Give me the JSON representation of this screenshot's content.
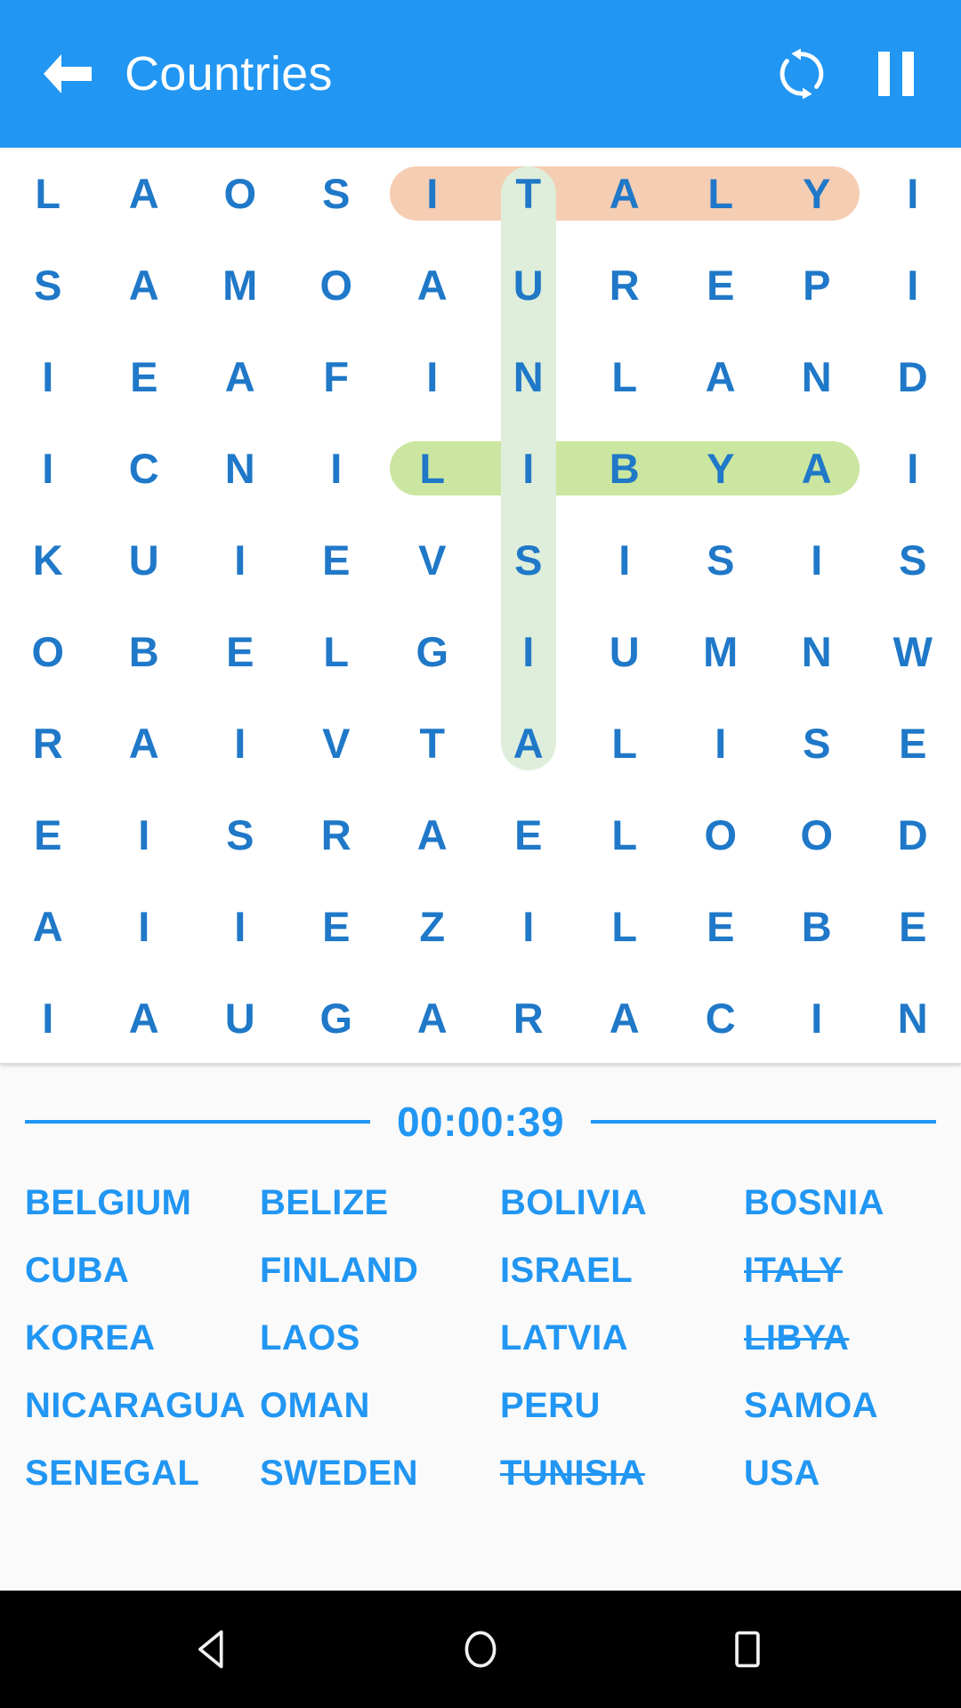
{
  "appbar": {
    "title": "Countries",
    "back_icon": "arrow-left-icon",
    "shuffle_icon": "refresh-shuffle-icon",
    "pause_icon": "pause-icon"
  },
  "grid": {
    "rows": 10,
    "cols": 10,
    "letters": [
      [
        "L",
        "A",
        "O",
        "S",
        "I",
        "T",
        "A",
        "L",
        "Y",
        "I"
      ],
      [
        "S",
        "A",
        "M",
        "O",
        "A",
        "U",
        "R",
        "E",
        "P",
        "I"
      ],
      [
        "I",
        "E",
        "A",
        "F",
        "I",
        "N",
        "L",
        "A",
        "N",
        "D"
      ],
      [
        "I",
        "C",
        "N",
        "I",
        "L",
        "I",
        "B",
        "Y",
        "A",
        "I"
      ],
      [
        "K",
        "U",
        "I",
        "E",
        "V",
        "S",
        "I",
        "S",
        "I",
        "S"
      ],
      [
        "O",
        "B",
        "E",
        "L",
        "G",
        "I",
        "U",
        "M",
        "N",
        "W"
      ],
      [
        "R",
        "A",
        "I",
        "V",
        "T",
        "A",
        "L",
        "I",
        "S",
        "E"
      ],
      [
        "E",
        "I",
        "S",
        "R",
        "A",
        "E",
        "L",
        "O",
        "O",
        "D"
      ],
      [
        "A",
        "I",
        "I",
        "E",
        "Z",
        "I",
        "L",
        "E",
        "B",
        "E"
      ],
      [
        "I",
        "A",
        "U",
        "G",
        "A",
        "R",
        "A",
        "C",
        "I",
        "N"
      ]
    ],
    "highlights": [
      {
        "word": "ITALY",
        "orientation": "horizontal",
        "row": 0,
        "col_start": 4,
        "col_end": 8,
        "color": "#F5CDB2"
      },
      {
        "word": "LIBYA",
        "orientation": "horizontal",
        "row": 3,
        "col_start": 4,
        "col_end": 8,
        "color": "#CBE6A0"
      },
      {
        "word": "TUNISIA",
        "orientation": "vertical",
        "col": 5,
        "row_start": 0,
        "row_end": 6,
        "color": "#DEEEDB"
      }
    ]
  },
  "timer": {
    "value": "00:00:39"
  },
  "wordlist": [
    {
      "text": "BELGIUM",
      "found": false
    },
    {
      "text": "BELIZE",
      "found": false
    },
    {
      "text": "BOLIVIA",
      "found": false
    },
    {
      "text": "BOSNIA",
      "found": false
    },
    {
      "text": "CUBA",
      "found": false
    },
    {
      "text": "FINLAND",
      "found": false
    },
    {
      "text": "ISRAEL",
      "found": false
    },
    {
      "text": "ITALY",
      "found": true
    },
    {
      "text": "KOREA",
      "found": false
    },
    {
      "text": "LAOS",
      "found": false
    },
    {
      "text": "LATVIA",
      "found": false
    },
    {
      "text": "LIBYA",
      "found": true
    },
    {
      "text": "NICARAGUA",
      "found": false
    },
    {
      "text": "OMAN",
      "found": false
    },
    {
      "text": "PERU",
      "found": false
    },
    {
      "text": "SAMOA",
      "found": false
    },
    {
      "text": "SENEGAL",
      "found": false
    },
    {
      "text": "SWEDEN",
      "found": false
    },
    {
      "text": "TUNISIA",
      "found": true
    },
    {
      "text": "USA",
      "found": false
    }
  ],
  "navbar": {
    "back_icon": "nav-back-triangle-icon",
    "home_icon": "nav-home-circle-icon",
    "recents_icon": "nav-recents-square-icon"
  },
  "colors": {
    "primary": "#2196F3",
    "letter": "#1f78c8",
    "highlight_found_1": "#F5CDB2",
    "highlight_found_2": "#CBE6A0",
    "highlight_found_3": "#DEEEDB"
  }
}
